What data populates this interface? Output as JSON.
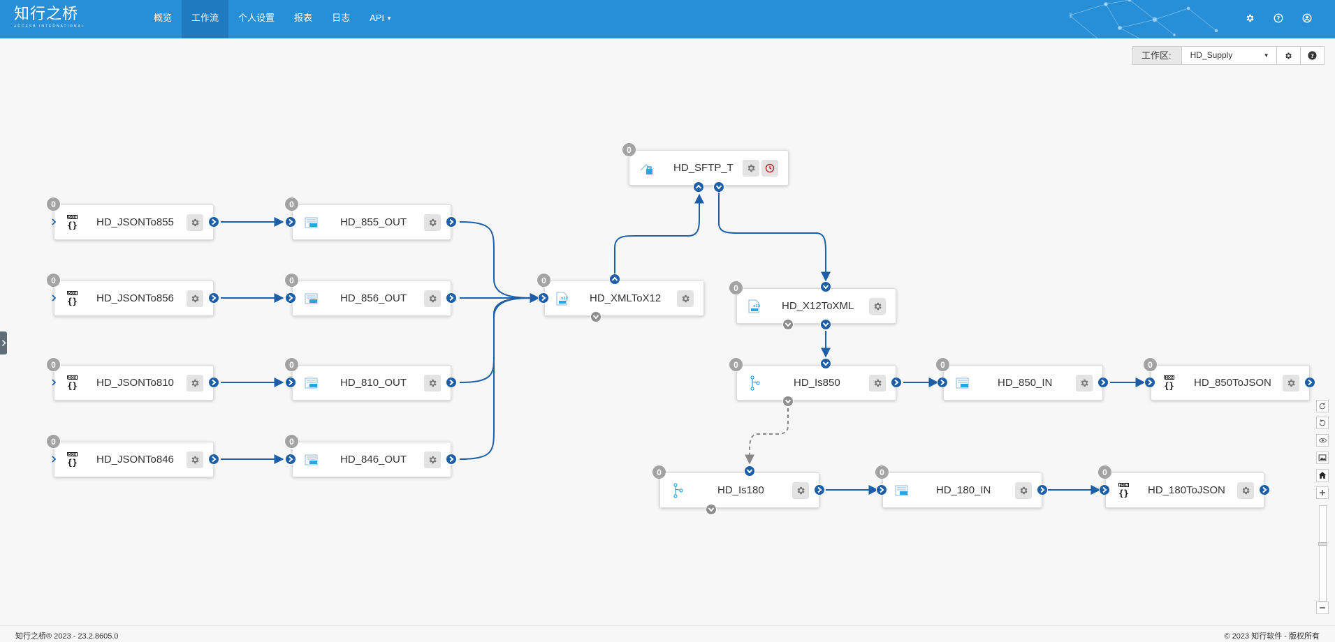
{
  "header": {
    "logo_text": "知行之桥",
    "logo_subtext": "ARCESB INTERNATIONAL",
    "nav": [
      {
        "label": "概览",
        "active": false
      },
      {
        "label": "工作流",
        "active": true
      },
      {
        "label": "个人设置",
        "active": false
      },
      {
        "label": "报表",
        "active": false
      },
      {
        "label": "日志",
        "active": false
      },
      {
        "label": "API",
        "active": false
      }
    ],
    "right_icons": [
      "gear-icon",
      "help-icon",
      "user-icon"
    ]
  },
  "workspace": {
    "label": "工作区:",
    "selected": "HD_Supply"
  },
  "colors": {
    "navbar": "#268fd8",
    "nav_active": "#1f7ac0",
    "port": "#1c5fa8",
    "badge": "#a3a3a3"
  },
  "nodes": [
    {
      "name": "HD_JSONTo855",
      "count": "0",
      "icon": "json-icon"
    },
    {
      "name": "HD_855_OUT",
      "count": "0",
      "icon": "as2-icon"
    },
    {
      "name": "HD_JSONTo856",
      "count": "0",
      "icon": "json-icon"
    },
    {
      "name": "HD_856_OUT",
      "count": "0",
      "icon": "as2-icon"
    },
    {
      "name": "HD_JSONTo810",
      "count": "0",
      "icon": "json-icon"
    },
    {
      "name": "HD_810_OUT",
      "count": "0",
      "icon": "as2-icon"
    },
    {
      "name": "HD_JSONTo846",
      "count": "0",
      "icon": "json-icon"
    },
    {
      "name": "HD_846_OUT",
      "count": "0",
      "icon": "as2-icon"
    },
    {
      "name": "HD_SFTP_T",
      "count": "0",
      "icon": "sftp-icon"
    },
    {
      "name": "HD_XMLToX12",
      "count": "0",
      "icon": "x12-icon"
    },
    {
      "name": "HD_X12ToXML",
      "count": "0",
      "icon": "x12-icon"
    },
    {
      "name": "HD_Is850",
      "count": "0",
      "icon": "branch-icon"
    },
    {
      "name": "HD_850_IN",
      "count": "0",
      "icon": "as2-icon"
    },
    {
      "name": "HD_850ToJSON",
      "count": "0",
      "icon": "json-icon"
    },
    {
      "name": "HD_Is180",
      "count": "0",
      "icon": "branch-icon"
    },
    {
      "name": "HD_180_IN",
      "count": "0",
      "icon": "as2-icon"
    },
    {
      "name": "HD_180ToJSON",
      "count": "0",
      "icon": "json-icon"
    }
  ],
  "toolbar": [
    "refresh-icon",
    "undo-icon",
    "eye-icon",
    "image-icon",
    "home-icon",
    "zoom-in-icon",
    "zoom-out-icon"
  ],
  "footer": {
    "left": "知行之桥® 2023 - 23.2.8605.0",
    "right": "© 2023 知行软件 - 版权所有"
  }
}
